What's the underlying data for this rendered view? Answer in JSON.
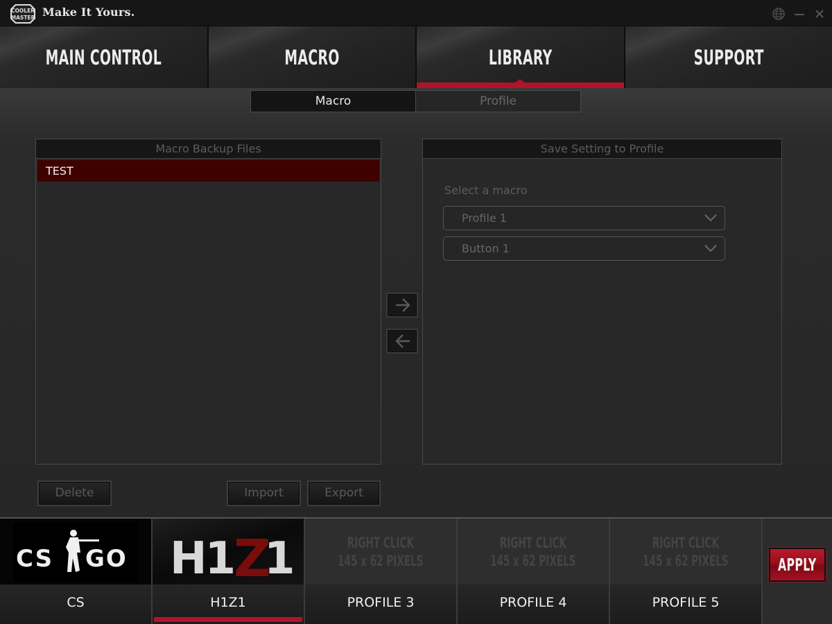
{
  "window": {
    "brand_text": "Make It Yours.",
    "logo_text_top": "COOLER",
    "logo_text_bottom": "MASTER",
    "controls": [
      {
        "name": "language",
        "icon": "globe-icon"
      },
      {
        "name": "minimize",
        "icon": "minimize-icon"
      },
      {
        "name": "close",
        "icon": "close-icon"
      }
    ]
  },
  "main_nav": {
    "tabs": [
      {
        "label": "MAIN CONTROL",
        "active": false
      },
      {
        "label": "MACRO",
        "active": false
      },
      {
        "label": "LIBRARY",
        "active": true
      },
      {
        "label": "SUPPORT",
        "active": false
      }
    ],
    "accent_color": "#b3132a"
  },
  "sub_tabs": [
    {
      "label": "Macro",
      "active": true
    },
    {
      "label": "Profile",
      "active": false
    }
  ],
  "backup_panel": {
    "title": "Macro Backup Files",
    "items": [
      {
        "label": "TEST",
        "selected": true
      }
    ],
    "buttons": {
      "delete": "Delete",
      "import": "Import",
      "export": "Export"
    }
  },
  "transfer": {
    "to_profile_icon": "arrow-right-icon",
    "from_profile_icon": "arrow-left-icon"
  },
  "save_panel": {
    "title": "Save Setting to Profile",
    "select_label": "Select a macro",
    "profile_select": {
      "value": "Profile 1"
    },
    "button_select": {
      "value": "Button 1"
    }
  },
  "profiles": [
    {
      "name": "CS",
      "image": "CS:GO logo",
      "logo_left": "CS",
      "logo_right": "GO",
      "active": false
    },
    {
      "name": "H1Z1",
      "image": "H1Z1 logo",
      "logo_text": "H1Z1",
      "active": true
    },
    {
      "name": "PROFILE 3",
      "placeholder_line1": "RIGHT CLICK",
      "placeholder_line2": "145 x 62 PIXELS",
      "active": false
    },
    {
      "name": "PROFILE 4",
      "placeholder_line1": "RIGHT CLICK",
      "placeholder_line2": "145 x 62 PIXELS",
      "active": false
    },
    {
      "name": "PROFILE 5",
      "placeholder_line1": "RIGHT CLICK",
      "placeholder_line2": "145 x 62 PIXELS",
      "active": false
    }
  ],
  "apply_label": "APPLY"
}
